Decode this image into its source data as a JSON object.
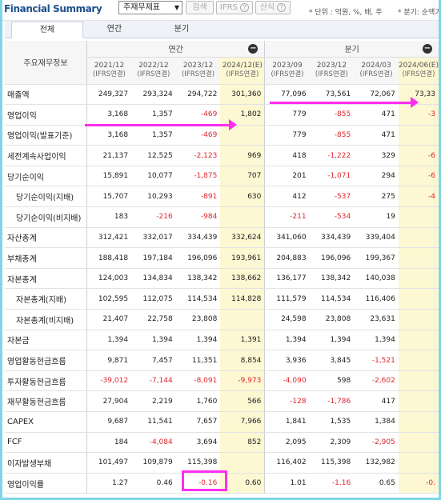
{
  "header": {
    "title": "Financial Summary",
    "select_value": "주재무제표",
    "search_button": "검색",
    "ifrs_button": "IFRS",
    "formula_button": "산식",
    "help_glyph": "?",
    "unit_text": "* 단위 : 억원, %, 배, 주",
    "period_text": "* 분기: 순액기"
  },
  "tabs": [
    {
      "label": "전체",
      "active": true
    },
    {
      "label": "연간",
      "active": false
    },
    {
      "label": "분기",
      "active": false
    }
  ],
  "table": {
    "row_header": "주요재무정보",
    "group_annual": "연간",
    "group_quarter": "분기",
    "toggle_glyph": "−",
    "periods": [
      {
        "date": "2021/12",
        "basis": "(IFRS연결)"
      },
      {
        "date": "2022/12",
        "basis": "(IFRS연결)"
      },
      {
        "date": "2023/12",
        "basis": "(IFRS연결)"
      },
      {
        "date": "2024/12(E)",
        "basis": "(IFRS연결)"
      },
      {
        "date": "2023/09",
        "basis": "(IFRS연결)"
      },
      {
        "date": "2023/12",
        "basis": "(IFRS연결)"
      },
      {
        "date": "2024/03",
        "basis": "(IFRS연결)"
      },
      {
        "date": "2024/06(E)",
        "basis": "(IFRS연결)"
      }
    ],
    "rows": [
      {
        "label": "매출액",
        "sub": false,
        "values": [
          "249,327",
          "293,324",
          "294,722",
          "301,360",
          "77,096",
          "73,561",
          "72,067",
          "73,33"
        ]
      },
      {
        "label": "영업이익",
        "sub": false,
        "values": [
          "3,168",
          "1,357",
          "-469",
          "1,802",
          "779",
          "-855",
          "471",
          "-3"
        ]
      },
      {
        "label": "영업이익(발표기준)",
        "sub": false,
        "values": [
          "3,168",
          "1,357",
          "-469",
          "",
          "779",
          "-855",
          "471",
          ""
        ]
      },
      {
        "label": "세전계속사업이익",
        "sub": false,
        "values": [
          "21,137",
          "12,525",
          "-2,123",
          "969",
          "418",
          "-1,222",
          "329",
          "-6"
        ]
      },
      {
        "label": "당기순이익",
        "sub": false,
        "values": [
          "15,891",
          "10,077",
          "-1,875",
          "707",
          "201",
          "-1,071",
          "294",
          "-6"
        ]
      },
      {
        "label": "당기순이익(지배)",
        "sub": true,
        "values": [
          "15,707",
          "10,293",
          "-891",
          "630",
          "412",
          "-537",
          "275",
          "-4"
        ]
      },
      {
        "label": "당기순이익(비지배)",
        "sub": true,
        "values": [
          "183",
          "-216",
          "-984",
          "",
          "-211",
          "-534",
          "19",
          ""
        ]
      },
      {
        "label": "자산총계",
        "sub": false,
        "values": [
          "312,421",
          "332,017",
          "334,439",
          "332,624",
          "341,060",
          "334,439",
          "339,404",
          ""
        ]
      },
      {
        "label": "부채총계",
        "sub": false,
        "values": [
          "188,418",
          "197,184",
          "196,096",
          "193,961",
          "204,883",
          "196,096",
          "199,367",
          ""
        ]
      },
      {
        "label": "자본총계",
        "sub": false,
        "values": [
          "124,003",
          "134,834",
          "138,342",
          "138,662",
          "136,177",
          "138,342",
          "140,038",
          ""
        ]
      },
      {
        "label": "자본총계(지배)",
        "sub": true,
        "values": [
          "102,595",
          "112,075",
          "114,534",
          "114,828",
          "111,579",
          "114,534",
          "116,406",
          ""
        ]
      },
      {
        "label": "자본총계(비지배)",
        "sub": true,
        "values": [
          "21,407",
          "22,758",
          "23,808",
          "",
          "24,598",
          "23,808",
          "23,631",
          ""
        ]
      },
      {
        "label": "자본금",
        "sub": false,
        "values": [
          "1,394",
          "1,394",
          "1,394",
          "1,391",
          "1,394",
          "1,394",
          "1,394",
          ""
        ]
      },
      {
        "label": "영업활동현금흐름",
        "sub": false,
        "values": [
          "9,871",
          "7,457",
          "11,351",
          "8,854",
          "3,936",
          "3,845",
          "-1,521",
          ""
        ]
      },
      {
        "label": "투자활동현금흐름",
        "sub": false,
        "values": [
          "-39,012",
          "-7,144",
          "-8,091",
          "-9,973",
          "-4,090",
          "598",
          "-2,602",
          ""
        ]
      },
      {
        "label": "재무활동현금흐름",
        "sub": false,
        "values": [
          "27,904",
          "2,219",
          "1,760",
          "566",
          "-128",
          "-1,786",
          "417",
          ""
        ]
      },
      {
        "label": "CAPEX",
        "sub": false,
        "values": [
          "9,687",
          "11,541",
          "7,657",
          "7,966",
          "1,841",
          "1,535",
          "1,384",
          ""
        ]
      },
      {
        "label": "FCF",
        "sub": false,
        "values": [
          "184",
          "-4,084",
          "3,694",
          "852",
          "2,095",
          "2,309",
          "-2,905",
          ""
        ]
      },
      {
        "label": "이자발생부채",
        "sub": false,
        "values": [
          "101,497",
          "109,879",
          "115,398",
          "",
          "116,402",
          "115,398",
          "132,982",
          ""
        ]
      },
      {
        "label": "영업이익률",
        "sub": false,
        "values": [
          "1.27",
          "0.46",
          "-0.16",
          "0.60",
          "1.01",
          "-1.16",
          "0.65",
          "-0."
        ]
      }
    ]
  },
  "colors": {
    "accent": "#ff2df0",
    "negative": "#e0262d",
    "estimate_bg": "#fdf7d2",
    "frame": "#7fd6e6"
  }
}
